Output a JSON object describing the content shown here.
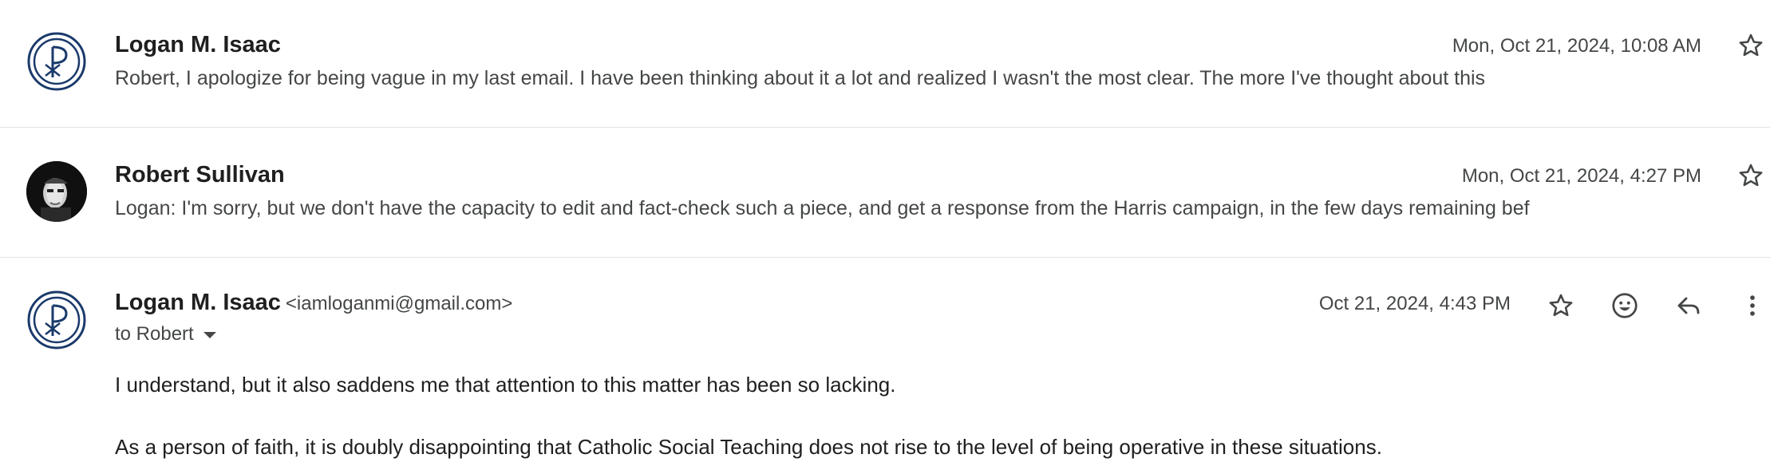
{
  "messages": [
    {
      "sender": "Logan M. Isaac",
      "date": "Mon, Oct 21, 2024, 10:08 AM",
      "snippet": "Robert, I apologize for being vague in my last email. I have been thinking about it a lot and realized I wasn't the most clear. The more I've thought about this",
      "avatar": "chi-rho-logo"
    },
    {
      "sender": "Robert Sullivan",
      "date": "Mon, Oct 21, 2024, 4:27 PM",
      "snippet": "Logan: I'm sorry, but we don't have the capacity to edit and fact-check such a piece, and get a response from the Harris campaign, in the few days remaining bef",
      "avatar": "photo"
    },
    {
      "sender": "Logan M. Isaac",
      "email": "<iamloganmi@gmail.com>",
      "date": "Oct 21, 2024, 4:43 PM",
      "to": "to Robert",
      "avatar": "chi-rho-logo",
      "body": [
        "I understand, but it also saddens me that attention to this matter has been so lacking.",
        "As a person of faith, it is doubly disappointing that Catholic Social Teaching does not rise to the level of being operative in these situations."
      ]
    }
  ],
  "icons": {
    "star": "star-icon",
    "emoji": "emoji-icon",
    "reply": "reply-icon",
    "more": "more-vert-icon"
  },
  "colors": {
    "logo": "#1a3a6b",
    "divider": "#e3e3e3",
    "text_primary": "#1f1f1f",
    "text_secondary": "#444746"
  }
}
